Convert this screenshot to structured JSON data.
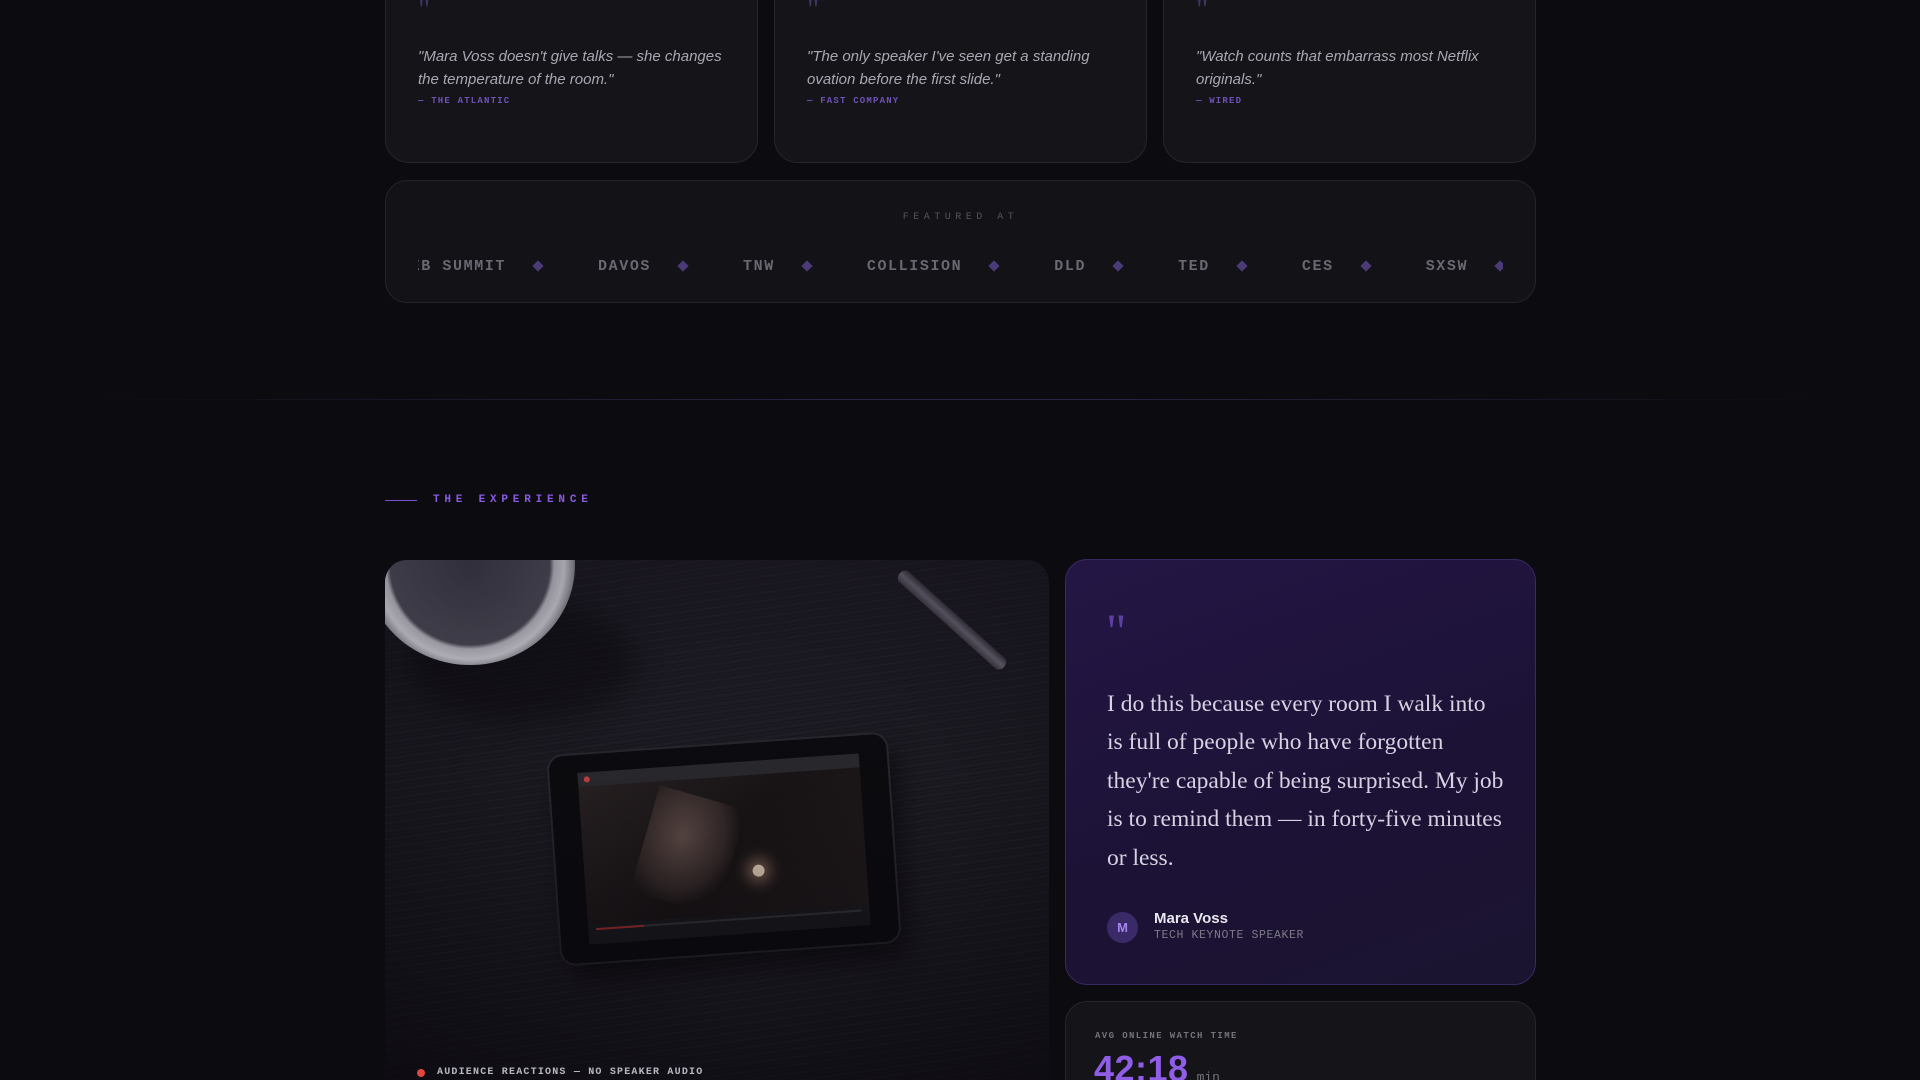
{
  "press_quotes": [
    {
      "text": "\"Mara Voss doesn't give talks — she changes the temperature of the room.\"",
      "source": "— THE ATLANTIC"
    },
    {
      "text": "\"The only speaker I've seen get a standing ovation before the first slide.\"",
      "source": "— FAST COMPANY"
    },
    {
      "text": "\"Watch counts that embarrass most Netflix originals.\"",
      "source": "— WIRED"
    }
  ],
  "quote_mark": "\"",
  "featured": {
    "label": "FEATURED AT",
    "venues": [
      "WEB SUMMIT",
      "DAVOS",
      "TNW",
      "COLLISION",
      "DLD",
      "TED",
      "CES",
      "SXSW"
    ]
  },
  "experience": {
    "section_label": "THE EXPERIENCE",
    "video_caption": "AUDIENCE REACTIONS — NO SPEAKER AUDIO"
  },
  "testimonial": {
    "quote_mark": "\"",
    "text": "I do this because every room I walk into is full of people who have forgotten they're capable of being surprised. My job is to remind them — in forty-five minutes or less.",
    "author_initial": "M",
    "author_name": "Mara Voss",
    "author_role": "TECH KEYNOTE SPEAKER"
  },
  "stat": {
    "label": "AVG ONLINE WATCH TIME",
    "value": "42:18",
    "unit": "min"
  },
  "colors": {
    "accent": "#8f5de6",
    "background": "#0c0c10",
    "live": "#e0463f"
  }
}
